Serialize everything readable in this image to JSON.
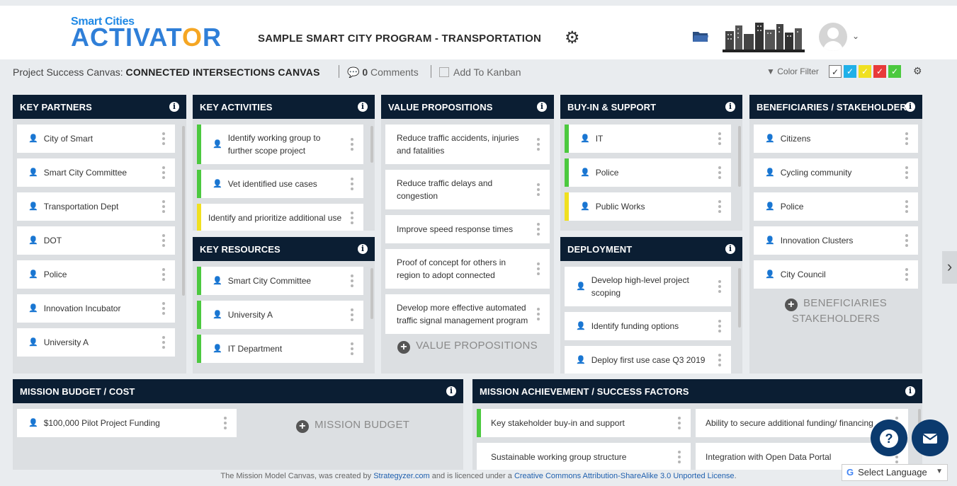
{
  "header": {
    "logo_top": "Smart Cities",
    "logo_main": "ACTIVAT",
    "logo_gear": "O",
    "logo_tail": "R",
    "program_title": "SAMPLE SMART CITY PROGRAM - TRANSPORTATION"
  },
  "subbar": {
    "canvas_prefix": "Project Success Canvas:",
    "canvas_name": "CONNECTED INTERSECTIONS CANVAS",
    "comments_count": "0",
    "comments_label": "Comments",
    "kanban_label": "Add To Kanban",
    "color_filter_label": "Color Filter",
    "swatch_colors": [
      "#ffffff",
      "#20b0e8",
      "#f0e020",
      "#e83a3a",
      "#4cc93f"
    ]
  },
  "key_partners": {
    "title": "KEY PARTNERS",
    "items": [
      "City of Smart",
      "Smart City Committee",
      "Transportation Dept",
      "DOT",
      "Police",
      "Innovation Incubator",
      "University A"
    ]
  },
  "key_activities": {
    "title": "KEY ACTIVITIES",
    "items": [
      "Identify working group to further scope project",
      "Vet identified use cases",
      "Identify and prioritize additional use"
    ]
  },
  "key_resources": {
    "title": "KEY RESOURCES",
    "items": [
      "Smart City Committee",
      "University A",
      "IT Department"
    ]
  },
  "value_propositions": {
    "title": "VALUE PROPOSITIONS",
    "items": [
      "Reduce traffic accidents, injuries and fatalities",
      "Reduce traffic delays and congestion",
      "Improve speed response times",
      "Proof of concept for others in region to adopt connected",
      "Develop more effective automated traffic signal management program"
    ],
    "add_label": "VALUE PROPOSITIONS"
  },
  "buy_in": {
    "title": "BUY-IN & SUPPORT",
    "items": [
      "IT",
      "Police",
      "Public Works"
    ]
  },
  "deployment": {
    "title": "DEPLOYMENT",
    "items": [
      "Develop high-level project scoping",
      "Identify funding options",
      "Deploy first use case Q3 2019"
    ]
  },
  "beneficiaries": {
    "title": "BENEFICIARIES / STAKEHOLDERS",
    "items": [
      "Citizens",
      "Cycling community",
      "Police",
      "Innovation Clusters",
      "City Council"
    ],
    "add_label_1": "BENEFICIARIES",
    "add_label_2": "STAKEHOLDERS"
  },
  "budget": {
    "title": "MISSION BUDGET / COST",
    "items": [
      "$100,000 Pilot Project Funding"
    ],
    "add_label": "MISSION BUDGET"
  },
  "achievement": {
    "title": "MISSION ACHIEVEMENT / SUCCESS FACTORS",
    "items": [
      "Key stakeholder buy-in and support",
      "Ability to secure additional funding/ financing",
      "Sustainable working group structure",
      "Integration with Open Data Portal"
    ]
  },
  "footer": {
    "prefix": "The Mission Model Canvas, was created by",
    "link1": "Strategyzer.com",
    "middle": "and is licenced under a",
    "link2": "Creative Commons Attribution-ShareAlike 3.0 Unported License",
    "suffix": "."
  },
  "language": {
    "label": "Select Language"
  }
}
